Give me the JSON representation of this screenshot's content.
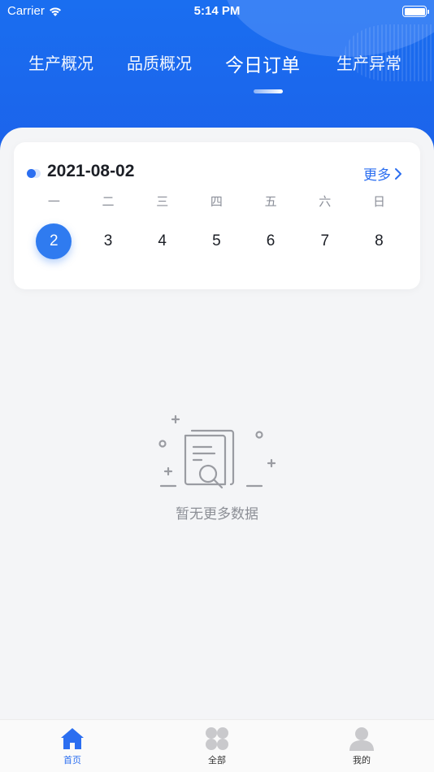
{
  "status_bar": {
    "carrier": "Carrier",
    "time": "5:14 PM"
  },
  "tabs": [
    {
      "label": "生产概况"
    },
    {
      "label": "品质概况"
    },
    {
      "label": "今日订单",
      "active": true
    },
    {
      "label": "生产异常"
    }
  ],
  "calendar": {
    "date": "2021-08-02",
    "more_label": "更多",
    "weekdays": [
      "一",
      "二",
      "三",
      "四",
      "五",
      "六",
      "日"
    ],
    "days": [
      "2",
      "3",
      "4",
      "5",
      "6",
      "7",
      "8"
    ],
    "selected_day": "2"
  },
  "empty_state": {
    "text": "暂无更多数据"
  },
  "tabbar": [
    {
      "label": "首页",
      "icon": "home-icon",
      "active": true
    },
    {
      "label": "全部",
      "icon": "grid-icon"
    },
    {
      "label": "我的",
      "icon": "user-icon"
    }
  ],
  "colors": {
    "primary": "#1a6ef0",
    "accent": "#2f7bf0",
    "background": "#f4f5f7"
  }
}
